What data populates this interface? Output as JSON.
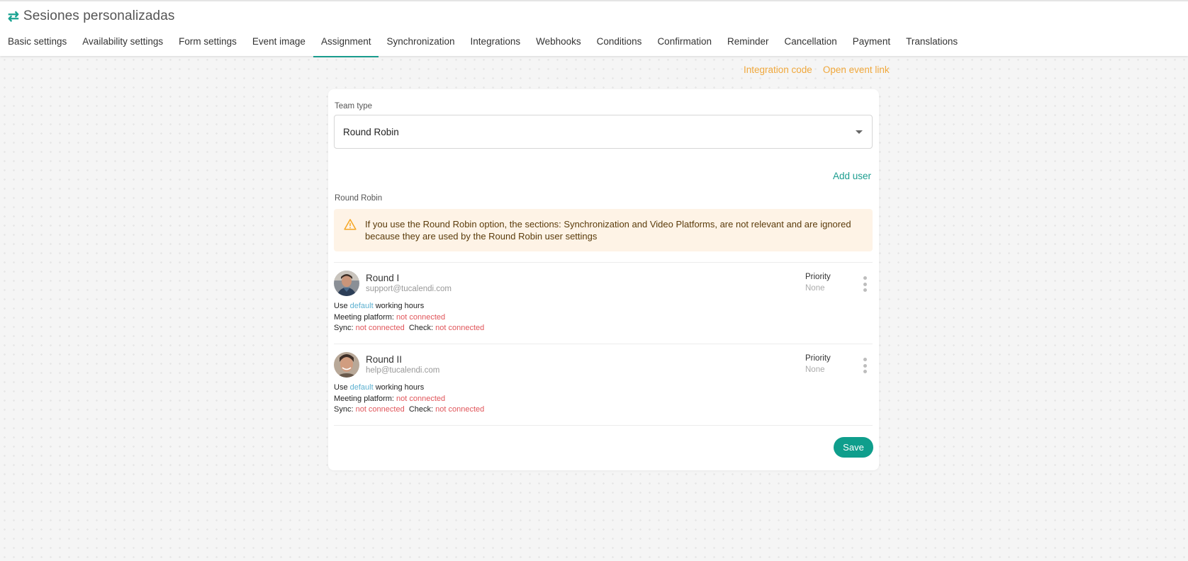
{
  "header": {
    "icon": "swap-arrows-icon",
    "title": "Sesiones personalizadas",
    "accent_color": "#1aa392"
  },
  "tabs": [
    {
      "label": "Basic settings",
      "active": false
    },
    {
      "label": "Availability settings",
      "active": false
    },
    {
      "label": "Form settings",
      "active": false
    },
    {
      "label": "Event image",
      "active": false
    },
    {
      "label": "Assignment",
      "active": true
    },
    {
      "label": "Synchronization",
      "active": false
    },
    {
      "label": "Integrations",
      "active": false
    },
    {
      "label": "Webhooks",
      "active": false
    },
    {
      "label": "Conditions",
      "active": false
    },
    {
      "label": "Confirmation",
      "active": false
    },
    {
      "label": "Reminder",
      "active": false
    },
    {
      "label": "Cancellation",
      "active": false
    },
    {
      "label": "Payment",
      "active": false
    },
    {
      "label": "Translations",
      "active": false
    }
  ],
  "top_links": {
    "integration_code": "Integration code",
    "open_event_link": "Open event link",
    "color": "#f0a83c"
  },
  "form": {
    "team_type_label": "Team type",
    "team_type_value": "Round Robin",
    "add_user_label": "Add user",
    "section_label": "Round Robin",
    "alert_icon": "warning-triangle-icon",
    "alert_text": "If you use the Round Robin option, the sections: Synchronization and Video Platforms, are not relevant and are ignored because they are used by the Round Robin user settings",
    "save_label": "Save"
  },
  "users": [
    {
      "name": "Round I",
      "email": "support@tucalendi.com",
      "use_prefix": "Use",
      "hours_link": "default",
      "hours_suffix": "working hours",
      "meeting_label": "Meeting platform:",
      "meeting_status": "not connected",
      "sync_label": "Sync:",
      "sync_status": "not connected",
      "check_label": "Check:",
      "check_status": "not connected",
      "priority_label": "Priority",
      "priority_value": "None"
    },
    {
      "name": "Round II",
      "email": "help@tucalendi.com",
      "use_prefix": "Use",
      "hours_link": "default",
      "hours_suffix": "working hours",
      "meeting_label": "Meeting platform:",
      "meeting_status": "not connected",
      "sync_label": "Sync:",
      "sync_status": "not connected",
      "check_label": "Check:",
      "check_status": "not connected",
      "priority_label": "Priority",
      "priority_value": "None"
    }
  ]
}
